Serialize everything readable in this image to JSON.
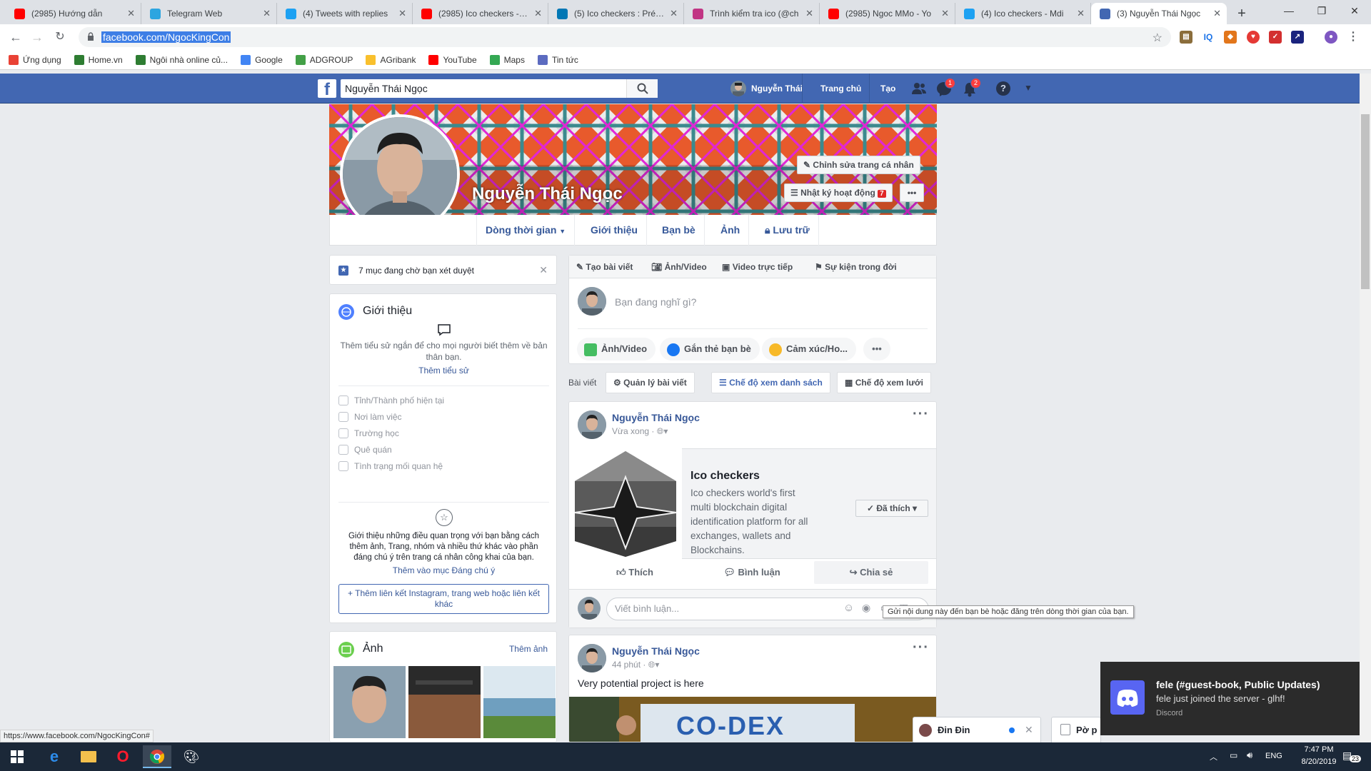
{
  "browser": {
    "tabs": [
      {
        "title": "(2985) Hướng dẫn",
        "icon": "youtube-icon",
        "color": "#ff0000",
        "muted": true
      },
      {
        "title": "Telegram Web",
        "icon": "telegram-icon",
        "color": "#2ca5e0"
      },
      {
        "title": "(4) Tweets with replies",
        "icon": "twitter-icon",
        "color": "#1da1f2"
      },
      {
        "title": "(2985) Ico checkers - Yo",
        "icon": "youtube-icon",
        "color": "#ff0000"
      },
      {
        "title": "(5) Ico checkers : Présen",
        "icon": "linkedin-icon",
        "color": "#0077b5"
      },
      {
        "title": "Trình kiểm tra ico (@ch",
        "icon": "instagram-icon",
        "color": "#c13584"
      },
      {
        "title": "(2985) Ngoc MMo - Yo",
        "icon": "youtube-icon",
        "color": "#ff0000"
      },
      {
        "title": "(4) Ico checkers - Mdi",
        "icon": "twitter-icon",
        "color": "#1da1f2"
      },
      {
        "title": "(3) Nguyễn Thái Ngọc",
        "icon": "facebook-icon",
        "color": "#4267b2",
        "active": true
      }
    ],
    "url": "facebook.com/NgocKingCon",
    "status_url": "https://www.facebook.com/NgocKingCon#",
    "bookmarks": [
      {
        "label": "Ứng dụng",
        "color": "#e94235"
      },
      {
        "label": "Home.vn",
        "color": "#2e7d32"
      },
      {
        "label": "Ngôi nhà online củ...",
        "color": "#2e7d32"
      },
      {
        "label": "Google",
        "color": "#4285f4"
      },
      {
        "label": "ADGROUP",
        "color": "#43a047"
      },
      {
        "label": "AGribank",
        "color": "#f9c02d"
      },
      {
        "label": "YouTube",
        "color": "#ff0000"
      },
      {
        "label": "Maps",
        "color": "#34a853"
      },
      {
        "label": "Tin tức",
        "color": "#5c6bc0"
      }
    ]
  },
  "fb": {
    "search_value": "Nguyễn Thái Ngọc",
    "nav": {
      "user": "Nguyễn Thái",
      "home": "Trang chủ",
      "create": "Tạo"
    },
    "badges": {
      "messages": "1",
      "notifications": "2"
    },
    "profile_name": "Nguyễn Thái Ngọc",
    "edit_profile": "Chỉnh sửa trang cá nhân",
    "activity_log": "Nhật ký hoạt động",
    "activity_count": "7",
    "profile_tabs": [
      "Dòng thời gian",
      "Giới thiệu",
      "Bạn bè",
      "Ảnh",
      "Lưu trữ"
    ],
    "pending": "7 mục đang chờ bạn xét duyệt",
    "intro": {
      "title": "Giới thiệu",
      "bio_prompt": "Thêm tiểu sử ngắn để cho mọi người biết thêm về bản thân bạn.",
      "bio_link": "Thêm tiểu sử",
      "rows": [
        "Tỉnh/Thành phố hiện tại",
        "Nơi làm việc",
        "Trường học",
        "Quê quán",
        "Tình trạng mối quan hệ"
      ],
      "featured_text": "Giới thiệu những điều quan trọng với bạn bằng cách thêm ảnh, Trang, nhóm và nhiều thứ khác vào phần đáng chú ý trên trang cá nhân công khai của bạn.",
      "featured_link": "Thêm vào mục Đáng chú ý",
      "add_links": "Thêm liên kết Instagram, trang web hoặc liên kết khác"
    },
    "photos": {
      "title": "Ảnh",
      "more": "Thêm ảnh"
    },
    "composer": {
      "tabs": [
        "Tạo bài viết",
        "Ảnh/Video",
        "Video trực tiếp",
        "Sự kiện trong đời"
      ],
      "placeholder": "Bạn đang nghĩ gì?",
      "actions": [
        "Ảnh/Video",
        "Gắn thẻ bạn bè",
        "Cảm xúc/Ho..."
      ]
    },
    "posts_bar": {
      "label": "Bài viết",
      "manage": "Quản lý bài viết",
      "list_view": "Chế độ xem danh sách",
      "grid_view": "Chế độ xem lưới"
    },
    "post1": {
      "author": "Nguyễn Thái Ngọc",
      "time": "Vừa xong",
      "page_name": "Ico checkers",
      "page_desc": "Ico checkers world's first multi blockchain digital identification platform for all exchanges, wallets and Blockchains.",
      "liked": "Đã thích",
      "like": "Thích",
      "comment": "Bình luận",
      "share": "Chia sẻ",
      "comment_placeholder": "Viết bình luận..."
    },
    "tooltip": "Gửi nội dung này đến bạn bè hoặc đăng trên dòng thời gian của bạn.",
    "post2": {
      "author": "Nguyễn Thái Ngọc",
      "time": "44 phút",
      "text": "Very potential project is here",
      "banner_text": "CO-DEX"
    },
    "chat": {
      "name": "Đin Đin",
      "second": "Pờ p"
    }
  },
  "notification": {
    "title": "fele (#guest-book, Public Updates)",
    "body": "fele just joined the server - glhf!",
    "app": "Discord"
  },
  "taskbar": {
    "lang": "ENG",
    "time": "7:47 PM",
    "date": "8/20/2019",
    "notif_count": "23"
  }
}
